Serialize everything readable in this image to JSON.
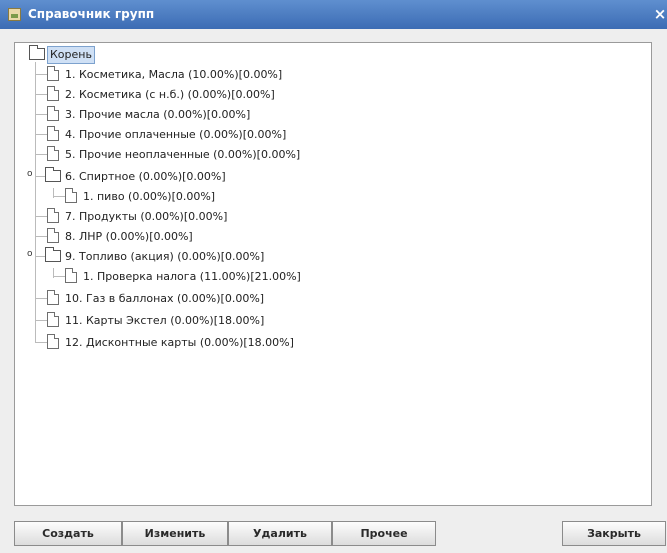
{
  "window": {
    "title": "Справочник групп",
    "close_glyph": "×"
  },
  "tree": {
    "root": "Корень",
    "items": [
      "1. Косметика, Масла (10.00%)[0.00%]",
      "2. Косметика (с н.б.) (0.00%)[0.00%]",
      "3. Прочие масла (0.00%)[0.00%]",
      "4. Прочие оплаченные (0.00%)[0.00%]",
      "5. Прочие неоплаченные (0.00%)[0.00%]",
      "6. Спиртное (0.00%)[0.00%]",
      "1. пиво (0.00%)[0.00%]",
      "7. Продукты (0.00%)[0.00%]",
      "8. ЛНР (0.00%)[0.00%]",
      "9. Топливо (акция) (0.00%)[0.00%]",
      "1. Проверка налога (11.00%)[21.00%]",
      "10. Газ в баллонах (0.00%)[0.00%]",
      "11. Карты Экстел (0.00%)[18.00%]",
      "12. Дисконтные карты (0.00%)[18.00%]"
    ],
    "expanded_glyph": "o"
  },
  "buttons": {
    "create": "Создать",
    "edit": "Изменить",
    "delete": "Удалить",
    "other": "Прочее",
    "close": "Закрыть"
  }
}
